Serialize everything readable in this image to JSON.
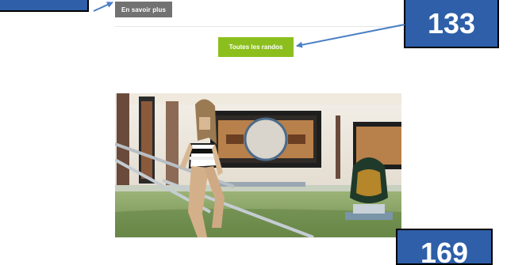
{
  "buttons": {
    "more_label": "En savoir plus",
    "all_label": "Toutes les randos"
  },
  "callouts": {
    "top": "133",
    "bottom": "169"
  },
  "colors": {
    "callout_blue": "#2e5fa8",
    "arrow_blue": "#4a7fc4",
    "more_gray": "#727272",
    "all_green": "#8cbf1e"
  },
  "image": {
    "subject": "woman-entering-spa-thermal-pool-photo"
  }
}
